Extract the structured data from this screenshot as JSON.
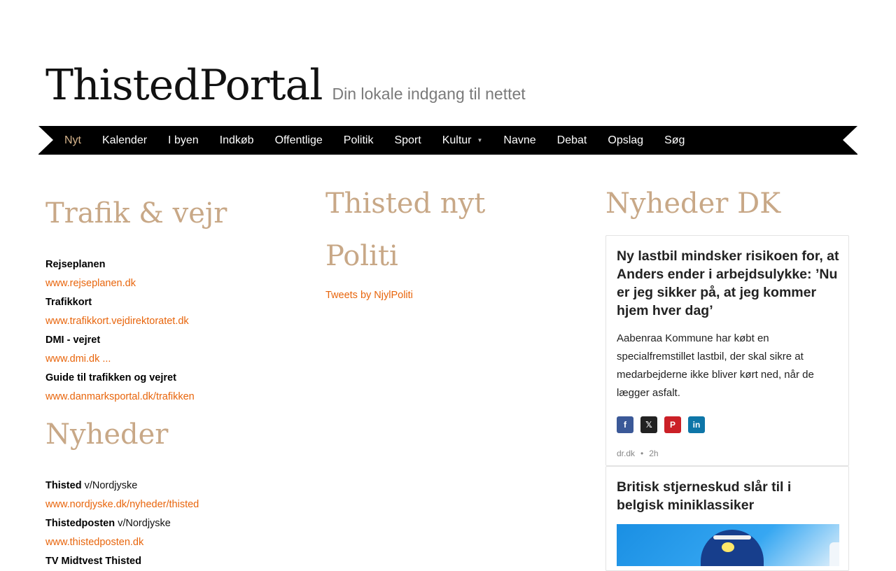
{
  "header": {
    "logo": "ThistedPortal",
    "tagline": "Din lokale indgang til nettet"
  },
  "nav": {
    "items": [
      "Nyt",
      "Kalender",
      "I byen",
      "Indkøb",
      "Offentlige",
      "Politik",
      "Sport",
      "Kultur",
      "Navne",
      "Debat",
      "Opslag",
      "Søg"
    ],
    "active": "Nyt",
    "dropdown_caret": "▼"
  },
  "traffic": {
    "title": "Trafik & vejr",
    "entries": [
      {
        "label": "Rejseplanen",
        "link": "www.rejseplanen.dk"
      },
      {
        "label": "Trafikkort",
        "link": "www.trafikkort.vejdirektoratet.dk"
      },
      {
        "label": "DMI - vejret",
        "link": "www.dmi.dk ..."
      },
      {
        "label": "Guide til trafikken og vejret",
        "link": "www.danmarksportal.dk/trafikken"
      }
    ]
  },
  "news": {
    "title": "Nyheder",
    "entries": [
      {
        "label": "Thisted",
        "suffix": " v/Nordjyske",
        "link": "www.nordjyske.dk/nyheder/thisted"
      },
      {
        "label": "Thistedposten",
        "suffix": " v/Nordjyske",
        "link": "www.thistedposten.dk"
      },
      {
        "label": "TV Midtvest Thisted",
        "suffix": ""
      }
    ]
  },
  "thisted_news": {
    "title": "Thisted nyt",
    "subtitle": "Politi",
    "tweets_link": "Tweets by NjylPoliti"
  },
  "dk_news": {
    "title": "Nyheder DK",
    "articles": [
      {
        "headline": "Ny lastbil mindsker risikoen for, at Anders ender i arbejdsulykke: ’Nu er jeg sikker på, at jeg kommer hjem hver dag’",
        "summary": "Aabenraa Kommune har købt en specialfremstillet lastbil, der skal sikre at medarbejderne ikke bliver kørt ned, når de lægger asfalt.",
        "source": "dr.dk",
        "age": "2h",
        "share_icons": [
          "facebook-icon",
          "x-icon",
          "pinterest-icon",
          "linkedin-icon"
        ]
      },
      {
        "headline": "Britisk stjerneskud slår til i belgisk miniklassiker"
      }
    ]
  },
  "colors": {
    "accent_link": "#e8650c",
    "section_title": "#c8a887",
    "nav_bg": "#000000",
    "nav_active": "#d6b48c"
  }
}
